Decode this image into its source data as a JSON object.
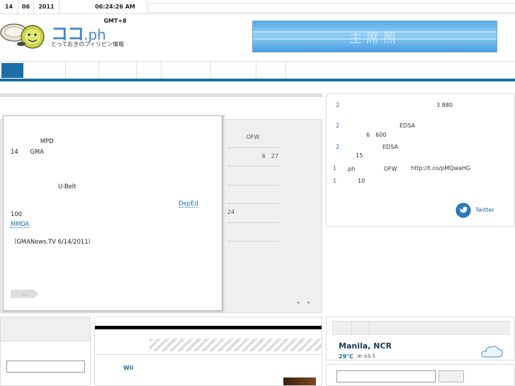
{
  "topbar": {
    "day": "14",
    "month": "06",
    "year": "2011",
    "clock": "06:24:26 AM GMT+8"
  },
  "logo": {
    "title": "ココ",
    "title_suffix": ".ph",
    "tagline": "とっておきのフィリピン情報"
  },
  "banner": {
    "text": "主席照"
  },
  "main_list": {
    "item_1": "OFW",
    "item_2": "6　27",
    "item_3": "24"
  },
  "popup": {
    "p1": "　　　　　MPD　　　　　　　　　　　　　　　　　　　　　　　　　　　　　　　　　　　　　　　　　　　　14　　GMA　　　　　　　",
    "p2": "　　　　　　　　　　　　　　　　　　　　　　　　　　　　　　　　　　　　　　　　　　　　　　　　　　　　　　　　　　　　　　　　　　　　　　　　　　　　　　",
    "p3": "　　　　　　　　U-Belt　　　　　　　　　　　　　　　　　　　　　　　　　　　　　　　　　　　　　　　　　　　　　　　　",
    "p4_a": "　　　　　　　　　　　　　　　　　　　　　　　　　　　　",
    "p4_link1": "DepEd",
    "p4_b": "　　　　　　　　　　　100　　　　　　　　　　　　　　　　　　　　　　　　　　　　　　　　　",
    "p4_link2": "MMDA",
    "p4_c": "　　　　　　　　　　　　　　　　　　　　　　　　　　　　　　",
    "source": "（GMANews.TV 6/14/2011）",
    "more_label": "…"
  },
  "tweets": {
    "t1_num": "2",
    "t1_text": "3 880",
    "t2_num": "2",
    "t2_text": "EDSA",
    "t2_sub": "6　600",
    "t3_num": "2",
    "t3_text": "EDSA",
    "t3_sub": "15",
    "t4_num": "1",
    "t4_text": ".ph　　　　　OFW",
    "t4_link": "http://t.co/pMQwaHG",
    "t5_num": "1",
    "t5_text": "10",
    "follow_label": "Twitter"
  },
  "bottom_mid": {
    "wii": "Wii",
    "item": "　"
  },
  "weather": {
    "city": "Manila, NCR",
    "temp": "29°C",
    "condition": "æ·±ã Š"
  },
  "colors": {
    "accent": "#1a6fa8",
    "logo_blue": "#4a86c5",
    "panel_gray": "#efefef"
  }
}
